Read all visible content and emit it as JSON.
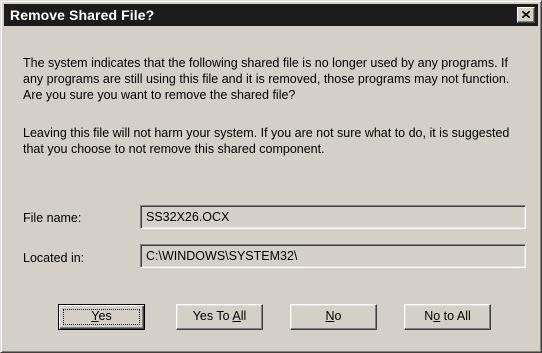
{
  "dialog": {
    "title": "Remove Shared File?",
    "message_1": "The system indicates that the following shared file is no longer used by any programs.  If any programs are still using this file and it is removed, those programs may not function.  Are you sure you want to remove the shared file?",
    "message_2": "Leaving this file will not harm your system.  If you are not sure what to do, it is suggested that you choose to not remove this shared component.",
    "file_name_label": "File name:",
    "file_name_value": "SS32X26.OCX",
    "located_in_label": "Located in:",
    "located_in_value": "C:\\WINDOWS\\SYSTEM32\\"
  },
  "buttons": {
    "yes": {
      "pre": "",
      "acc": "Y",
      "post": "es"
    },
    "yes_to_all": {
      "pre": "Yes To ",
      "acc": "A",
      "post": "ll"
    },
    "no": {
      "pre": "",
      "acc": "N",
      "post": "o"
    },
    "no_to_all": {
      "pre": "N",
      "acc": "o",
      "post": " to All"
    }
  },
  "icons": {
    "close": "close-icon"
  },
  "colors": {
    "titlebar": "#1c1c1c",
    "face": "#d4d0c8"
  }
}
